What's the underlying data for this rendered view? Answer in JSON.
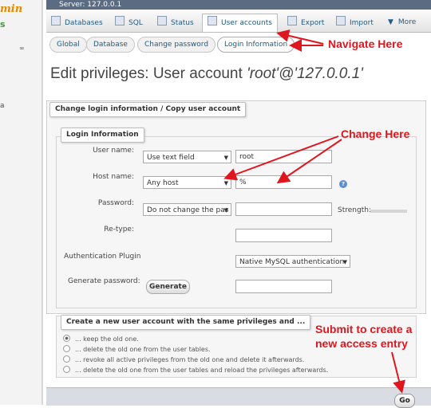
{
  "colors": {
    "accent": "#235a81",
    "annotation": "#e0161e",
    "header_bar": "#5b6c82",
    "logo": "#e68a00"
  },
  "sidebar": {
    "logo_text": "min",
    "green_mark": "s",
    "glyph_a": "a"
  },
  "server_bar": {
    "label": "Server: 127.0.0.1"
  },
  "tabs": [
    {
      "label": "Databases",
      "icon": "database-icon"
    },
    {
      "label": "SQL",
      "icon": "sql-icon"
    },
    {
      "label": "Status",
      "icon": "status-icon"
    },
    {
      "label": "User accounts",
      "icon": "users-icon",
      "active": true
    },
    {
      "label": "Export",
      "icon": "export-icon"
    },
    {
      "label": "Import",
      "icon": "import-icon"
    },
    {
      "label": "More",
      "icon": "chevron-down-icon"
    }
  ],
  "subtabs": [
    {
      "label": "Global"
    },
    {
      "label": "Database"
    },
    {
      "label": "Change password"
    },
    {
      "label": "Login Information",
      "active": true
    }
  ],
  "page_title": {
    "prefix": "Edit privileges: User account ",
    "account": "'root'@'127.0.0.1'"
  },
  "login_section": {
    "legend": "Change login information / Copy user account",
    "inner_legend": "Login Information",
    "fields": {
      "user_name": {
        "label": "User name:",
        "select": "Use text field",
        "value": "root"
      },
      "host_name": {
        "label": "Host name:",
        "select": "Any host",
        "value": "%"
      },
      "password": {
        "label": "Password:",
        "select": "Do not change the pas",
        "value": "",
        "strength_label": "Strength:"
      },
      "retype": {
        "label": "Re-type:",
        "value": ""
      },
      "auth_plugin": {
        "label": "Authentication Plugin",
        "select": "Native MySQL authentication"
      },
      "generate": {
        "label": "Generate password:",
        "button": "Generate",
        "value": ""
      }
    }
  },
  "copy_section": {
    "legend": "Create a new user account with the same privileges and ...",
    "options": [
      {
        "label": "... keep the old one.",
        "selected": true
      },
      {
        "label": "... delete the old one from the user tables.",
        "selected": false
      },
      {
        "label": "... revoke all active privileges from the old one and delete it afterwards.",
        "selected": false
      },
      {
        "label": "... delete the old one from the user tables and reload the privileges afterwards.",
        "selected": false
      }
    ]
  },
  "footer": {
    "go_label": "Go"
  },
  "annotations": {
    "navigate": "Navigate Here",
    "change": "Change Here",
    "submit_line1": "Submit to create a",
    "submit_line2": "new access entry"
  }
}
